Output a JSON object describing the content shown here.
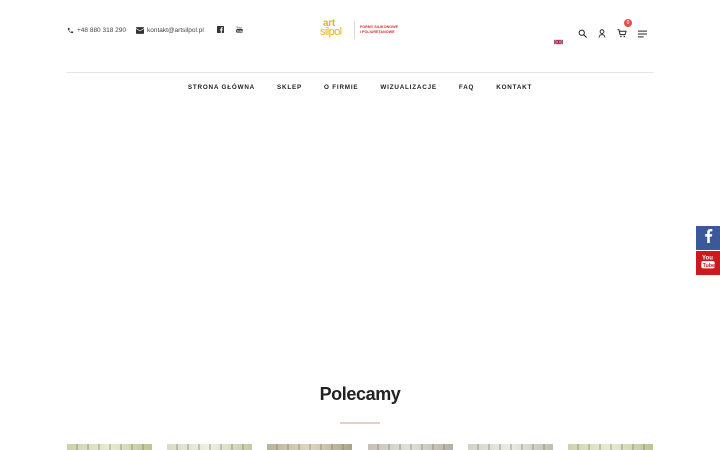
{
  "header": {
    "phone": "+48 880 318 290",
    "email": "kontakt@artsilpol.pl",
    "logo": {
      "line1": "art",
      "line2": "silpol",
      "tagline_1": "FORMY SILIKONOWE",
      "tagline_2": "I POLIURETANOWE"
    },
    "cart_count": "0"
  },
  "nav": {
    "items": [
      "STRONA GŁÓWNA",
      "SKLEP",
      "O FIRMIE",
      "WIZUALIZACJE",
      "FAQ",
      "KONTAKT"
    ]
  },
  "featured": {
    "title": "Polecamy"
  },
  "colors": {
    "brand_yellow": "#e8b31c",
    "brand_red": "#d72c2c",
    "facebook": "#3b5998",
    "youtube": "#cc181e",
    "badge": "#e74c4c"
  },
  "icons": [
    "phone-icon",
    "envelope-icon",
    "facebook-icon",
    "youtube-icon",
    "flag-uk-icon",
    "search-icon",
    "user-icon",
    "cart-icon",
    "menu-icon"
  ]
}
